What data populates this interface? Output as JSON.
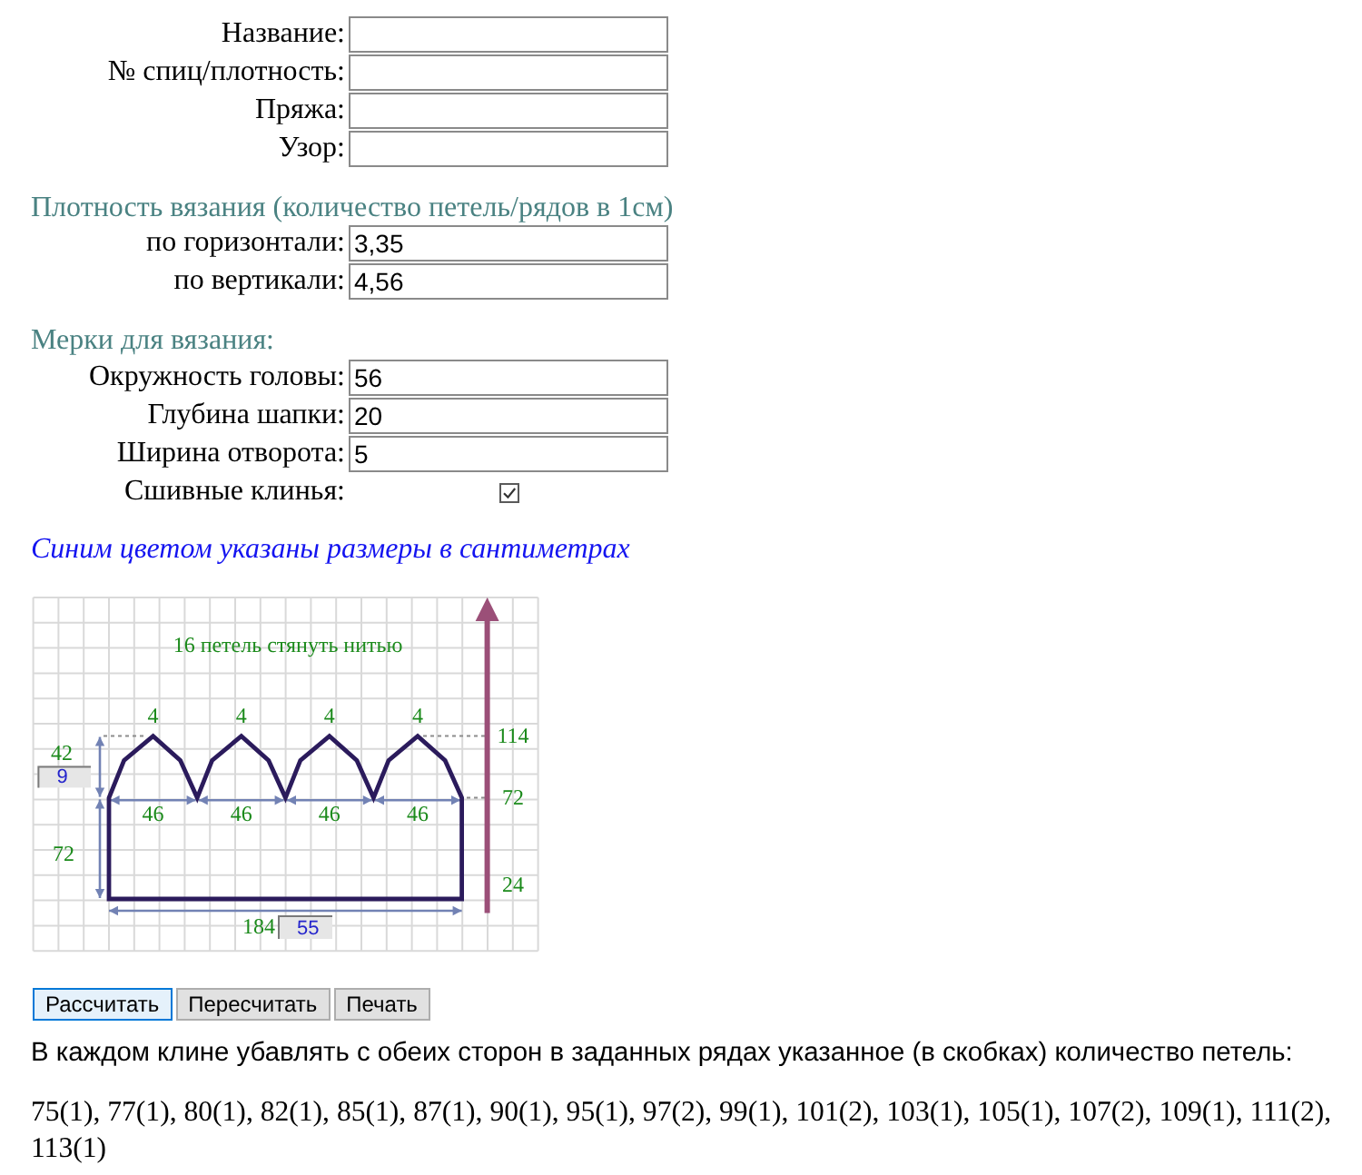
{
  "identity_fields": [
    {
      "label": "Название:"
    },
    {
      "label": "№ спиц/плотность:"
    },
    {
      "label": "Пряжа:"
    },
    {
      "label": "Узор:"
    }
  ],
  "gauge": {
    "title": "Плотность вязания (количество петель/рядов в 1см)",
    "fields": [
      {
        "label": "по горизонтали:",
        "value": "3,35"
      },
      {
        "label": "по вертикали:",
        "value": "4,56"
      }
    ]
  },
  "measurements": {
    "title": "Мерки для вязания:",
    "fields": [
      {
        "label": "Окружность головы:",
        "value": "56"
      },
      {
        "label": "Глубина шапки:",
        "value": "20"
      },
      {
        "label": "Ширина отворота:",
        "value": "5"
      }
    ],
    "sewn_wedges": {
      "label": "Сшивные клинья:",
      "checked": true
    }
  },
  "diagram_caption": "Синим цветом указаны размеры в сантиметрах",
  "diagram": {
    "note": "16 петель стянуть нитью",
    "wedge_top_labels": [
      "4",
      "4",
      "4",
      "4"
    ],
    "wedge_width_labels": [
      "46",
      "46",
      "46",
      "46"
    ],
    "wedge_height_label": "42",
    "wedge_height_field": "9",
    "band_height_label": "72",
    "width_label": "184",
    "width_field": "55",
    "row_marks": [
      "114",
      "72",
      "24"
    ]
  },
  "buttons": [
    {
      "label": "Рассчитать",
      "focused": true
    },
    {
      "label": "Пересчитать",
      "focused": false
    },
    {
      "label": "Печать",
      "focused": false
    }
  ],
  "result": {
    "intro": "В каждом клине убавлять с обеих сторон в заданных рядах указанное (в скобках) количество петель:",
    "rows": "75(1), 77(1), 80(1), 82(1), 85(1), 87(1), 90(1), 95(1), 97(2), 99(1), 101(2), 103(1), 105(1), 107(2), 109(1), 111(2), 113(1)"
  }
}
